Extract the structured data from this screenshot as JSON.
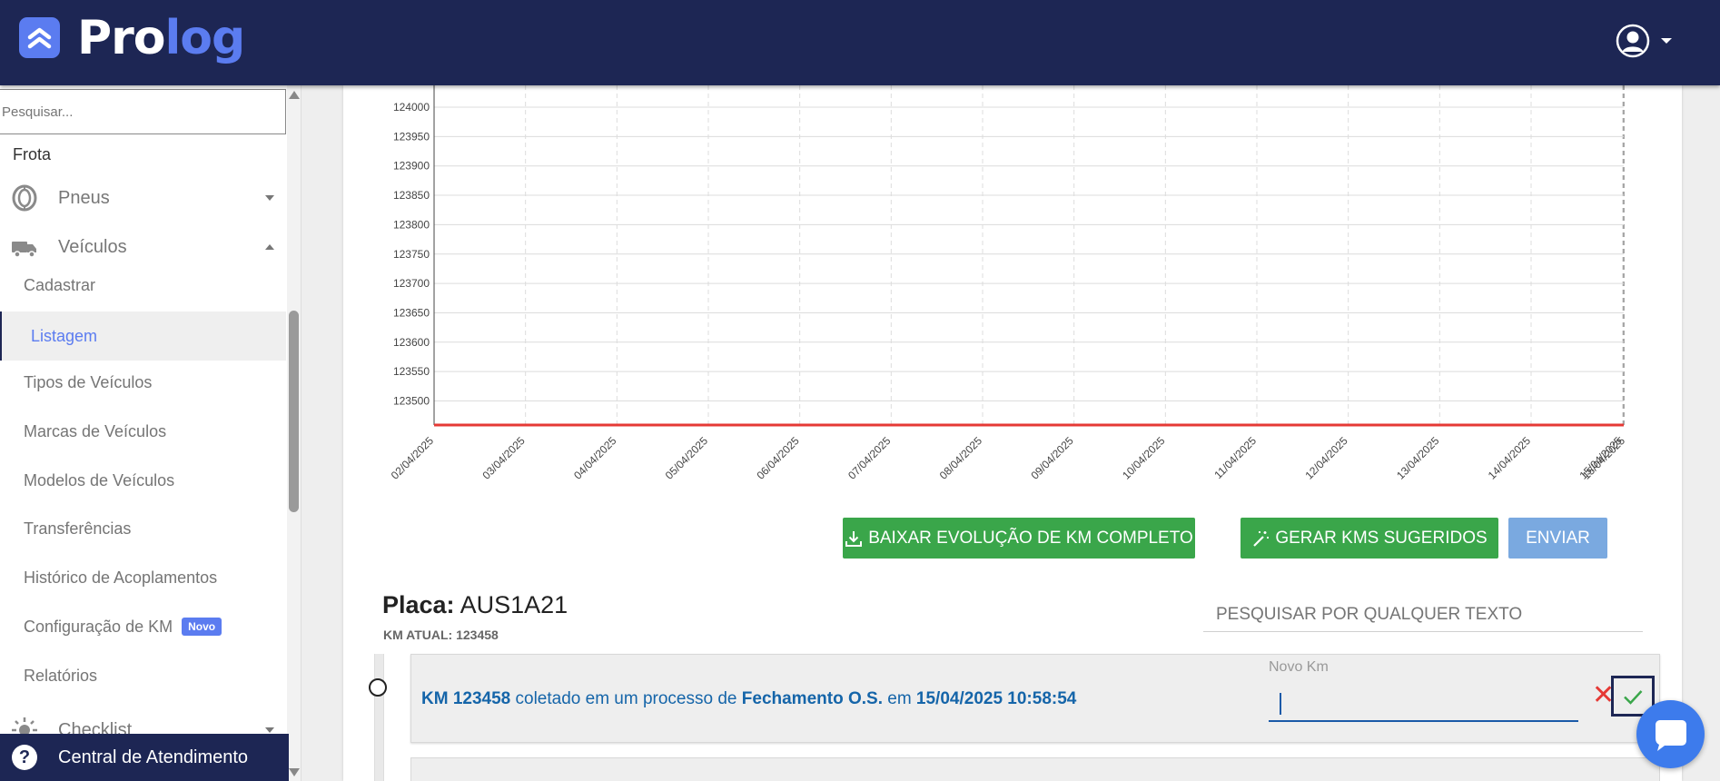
{
  "header": {
    "logo_part1": "Pro",
    "logo_part2": "log"
  },
  "sidebar": {
    "search_placeholder": "Pesquisar...",
    "section": "Frota",
    "groups": [
      {
        "label": "Pneus",
        "icon": "tire-icon",
        "expanded": false
      },
      {
        "label": "Veículos",
        "icon": "truck-icon",
        "expanded": true
      },
      {
        "label": "Checklist",
        "icon": "sun-icon",
        "expanded": false
      }
    ],
    "items": [
      {
        "label": "Cadastrar"
      },
      {
        "label": "Listagem",
        "active": true
      },
      {
        "label": "Tipos de Veículos"
      },
      {
        "label": "Marcas de Veículos"
      },
      {
        "label": "Modelos de Veículos"
      },
      {
        "label": "Transferências"
      },
      {
        "label": "Histórico de Acoplamentos"
      },
      {
        "label": "Configuração de KM",
        "badge": "Novo"
      },
      {
        "label": "Relatórios"
      }
    ],
    "help_label": "Central de Atendimento"
  },
  "chart_data": {
    "type": "line",
    "title": "",
    "xlabel": "",
    "ylabel": "",
    "x": [
      "02/04/2025",
      "03/04/2025",
      "04/04/2025",
      "05/04/2025",
      "06/04/2025",
      "07/04/2025",
      "08/04/2025",
      "09/04/2025",
      "10/04/2025",
      "11/04/2025",
      "12/04/2025",
      "13/04/2025",
      "14/04/2025",
      "15/04/2025",
      "15/04/2025"
    ],
    "y_ticks": [
      124000,
      123950,
      123900,
      123850,
      123800,
      123750,
      123700,
      123650,
      123600,
      123550,
      123500
    ],
    "ylim": [
      123458,
      124000
    ],
    "series": [
      {
        "values": [
          123458,
          123458,
          123458,
          123458,
          123458,
          123458,
          123458,
          123458,
          123458,
          123458,
          123458,
          123458,
          123458,
          123458,
          123458
        ],
        "color": "#e53935"
      }
    ],
    "grid": true
  },
  "buttons": {
    "download": "BAIXAR EVOLUÇÃO DE KM COMPLETO",
    "generate": "GERAR KMS SUGERIDOS",
    "send": "ENVIAR"
  },
  "vehicle": {
    "placa_label": "Placa:",
    "placa_value": "AUS1A21",
    "km_atual": "KM ATUAL: 123458"
  },
  "search_all": {
    "placeholder": "PESQUISAR POR QUALQUER TEXTO"
  },
  "entries": [
    {
      "km": "KM 123458",
      "text1": " coletado em um processo de ",
      "process": "Fechamento O.S.",
      "text2": " em ",
      "datetime": "15/04/2025 10:58:54",
      "new_km_label": "Novo Km",
      "new_km_value": ""
    }
  ],
  "colors": {
    "header_bg": "#1d2654",
    "accent": "#5b7cf0",
    "green": "#3aa64a",
    "send_blue": "#7aa9e0",
    "line_red": "#e53935"
  }
}
